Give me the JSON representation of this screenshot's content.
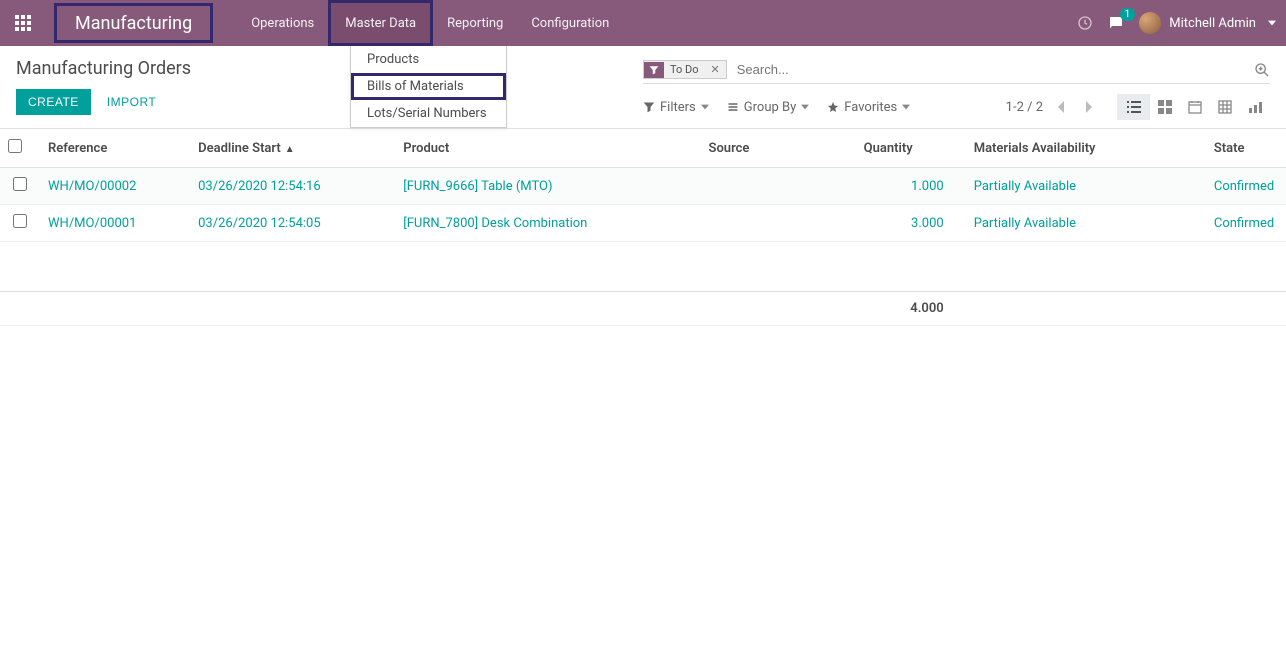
{
  "header": {
    "brand": "Manufacturing",
    "menu": [
      "Operations",
      "Master Data",
      "Reporting",
      "Configuration"
    ],
    "user": "Mitchell Admin",
    "chat_badge": "1"
  },
  "dropdown": {
    "items": [
      "Products",
      "Bills of Materials",
      "Lots/Serial Numbers"
    ]
  },
  "breadcrumb": "Manufacturing Orders",
  "buttons": {
    "create": "CREATE",
    "import": "IMPORT"
  },
  "search": {
    "facet_label": "To Do",
    "placeholder": "Search..."
  },
  "filters": {
    "filters": "Filters",
    "groupby": "Group By",
    "favorites": "Favorites"
  },
  "pager": "1-2 / 2",
  "columns": {
    "reference": "Reference",
    "deadline": "Deadline Start",
    "product": "Product",
    "source": "Source",
    "quantity": "Quantity",
    "materials": "Materials Availability",
    "state": "State"
  },
  "rows": [
    {
      "reference": "WH/MO/00002",
      "deadline": "03/26/2020 12:54:16",
      "product": "[FURN_9666] Table (MTO)",
      "source": "",
      "quantity": "1.000",
      "materials": "Partially Available",
      "state": "Confirmed"
    },
    {
      "reference": "WH/MO/00001",
      "deadline": "03/26/2020 12:54:05",
      "product": "[FURN_7800] Desk Combination",
      "source": "",
      "quantity": "3.000",
      "materials": "Partially Available",
      "state": "Confirmed"
    }
  ],
  "total_quantity": "4.000"
}
